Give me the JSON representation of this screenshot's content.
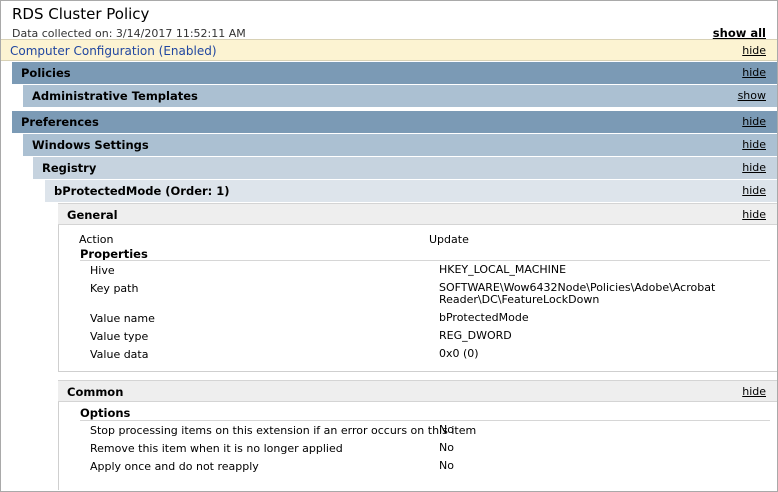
{
  "header": {
    "title": "RDS Cluster Policy",
    "collected": "Data collected on: 3/14/2017 11:52:11 AM",
    "show_all": "show all"
  },
  "computer_config": {
    "label": "Computer Configuration (Enabled)",
    "toggle": "hide"
  },
  "policies": {
    "label": "Policies",
    "toggle": "hide"
  },
  "admin_templates": {
    "label": "Administrative Templates",
    "toggle": "show"
  },
  "preferences": {
    "label": "Preferences",
    "toggle": "hide"
  },
  "windows_settings": {
    "label": "Windows Settings",
    "toggle": "hide"
  },
  "registry": {
    "label": "Registry",
    "toggle": "hide"
  },
  "item": {
    "label": "bProtectedMode (Order: 1)",
    "toggle": "hide"
  },
  "general": {
    "label": "General",
    "toggle": "hide",
    "action_label": "Action",
    "action_value": "Update",
    "properties_label": "Properties",
    "properties": [
      {
        "name": "Hive",
        "value": "HKEY_LOCAL_MACHINE"
      },
      {
        "name": "Key path",
        "value_line1": "SOFTWARE\\Wow6432Node\\Policies\\Adobe\\Acrobat",
        "value_line2": "Reader\\DC\\FeatureLockDown"
      },
      {
        "name": "Value name",
        "value": "bProtectedMode"
      },
      {
        "name": "Value type",
        "value": "REG_DWORD"
      },
      {
        "name": "Value data",
        "value": "0x0 (0)"
      }
    ]
  },
  "common": {
    "label": "Common",
    "toggle": "hide",
    "options_label": "Options",
    "options": [
      {
        "name": "Stop processing items on this extension if an error occurs on this item",
        "value": "No"
      },
      {
        "name": "Remove this item when it is no longer applied",
        "value": "No"
      },
      {
        "name": "Apply once and do not reapply",
        "value": "No"
      }
    ]
  }
}
